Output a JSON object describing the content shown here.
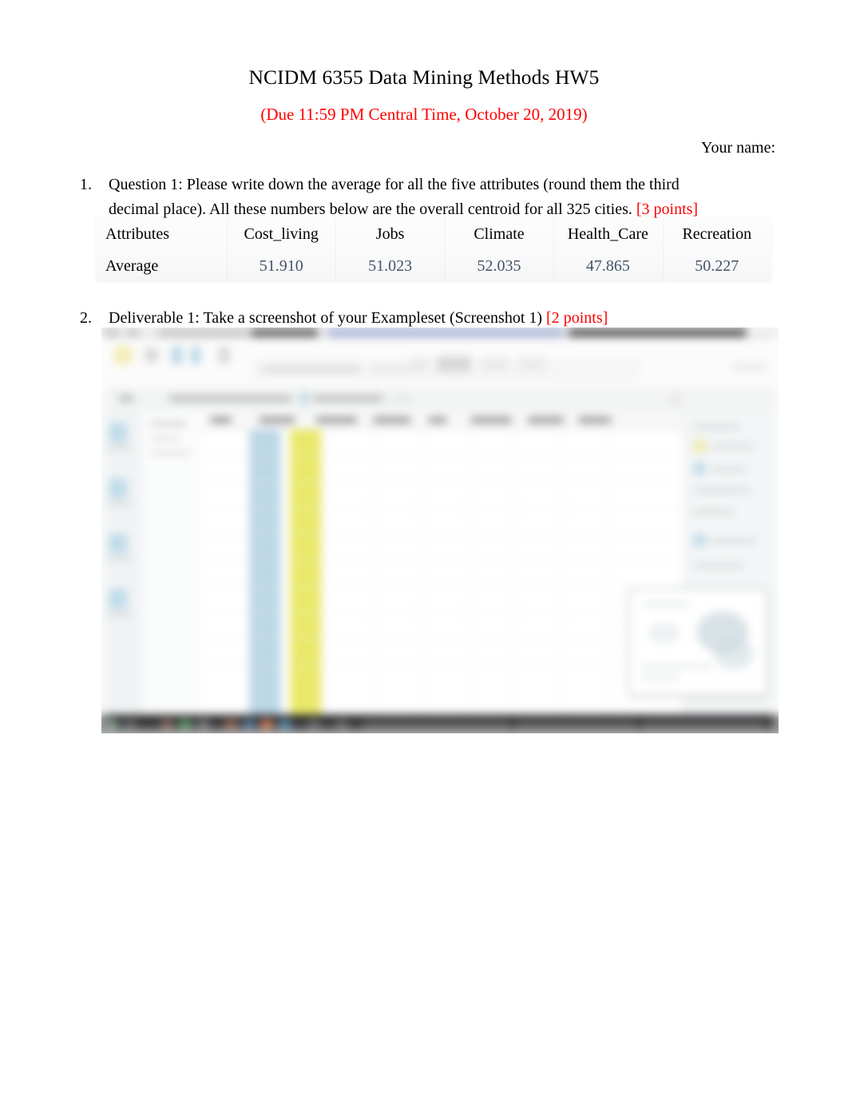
{
  "document": {
    "title": "NCIDM 6355 Data Mining Methods HW5",
    "due_note": "(Due 11:59 PM Central Time, October 20, 2019)",
    "due_note_color": "#ff0000",
    "name_field_label": "Your name:"
  },
  "questions": [
    {
      "number": "1.",
      "text_line1": "Question 1: Please write down the average for all the five attributes (round them the third",
      "text_line2": "decimal place). All these numbers below are the overall centroid for all 325 cities.",
      "points": "[3 points]",
      "points_color": "#ff0000"
    },
    {
      "number": "2.",
      "text": "Deliverable 1: Take a screenshot of your Exampleset (Screenshot 1)",
      "points": "[2 points]",
      "points_color": "#ff0000"
    }
  ],
  "centroid_table": {
    "value_color": "#44546a",
    "header": {
      "label": "Attributes",
      "cells": [
        "Cost_living",
        "Jobs",
        "Climate",
        "Health_Care",
        "Recreation"
      ]
    },
    "average_row": {
      "label": "Average",
      "cells": [
        "51.910",
        "51.023",
        "52.035",
        "47.865",
        "50.227"
      ]
    }
  },
  "embedded_screenshot": {
    "name": "screenshot-1-exampleset",
    "description": "Blurred screenshot of a data mining application window showing an example set table with a highlighted blue column and highlighted yellow column, a left icon rail, a right properties pane, a floating preview thumbnail, and a dark taskbar."
  }
}
